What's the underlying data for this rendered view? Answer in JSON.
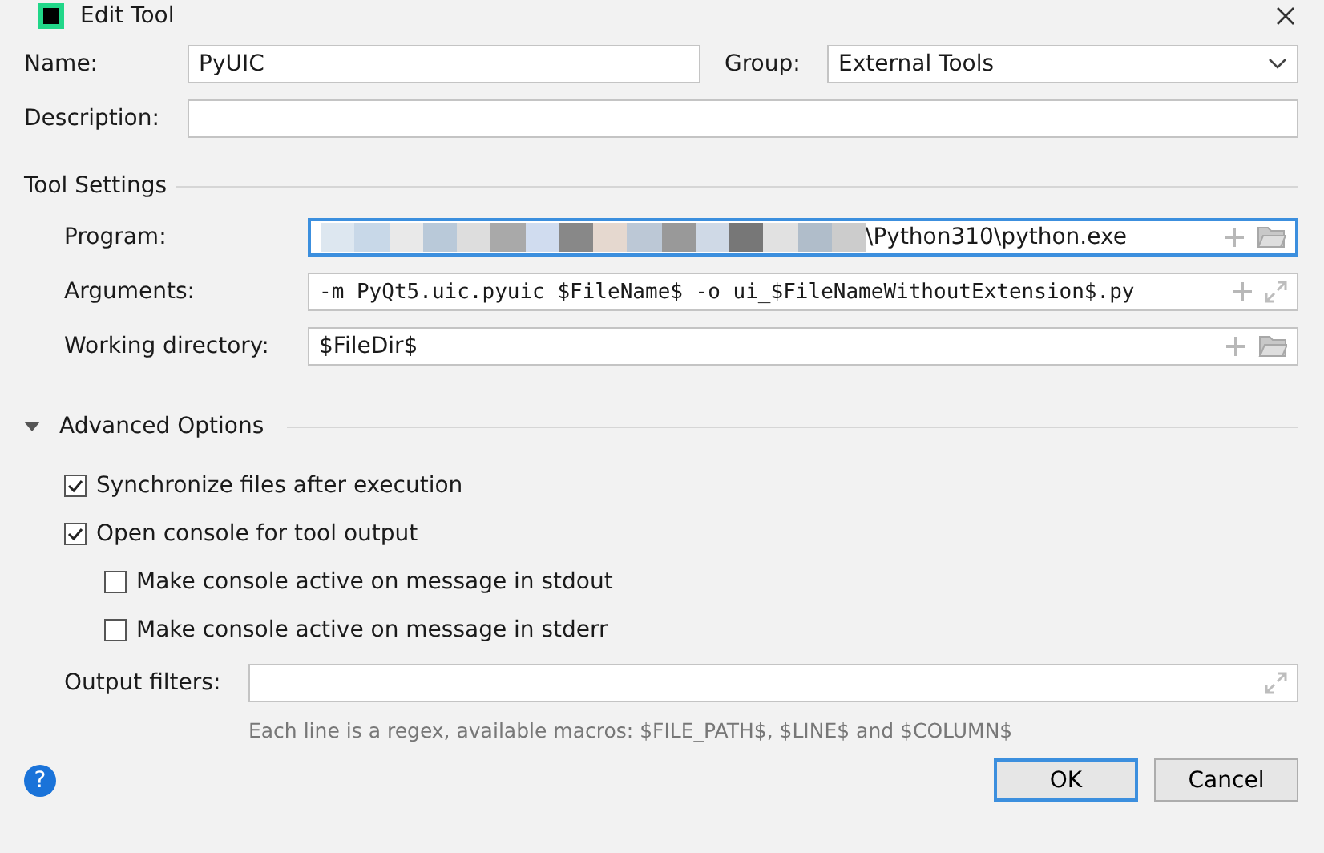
{
  "window": {
    "title": "Edit Tool"
  },
  "name": {
    "label": "Name:",
    "value": "PyUIC"
  },
  "group": {
    "label": "Group:",
    "value": "External Tools"
  },
  "description": {
    "label": "Description:"
  },
  "tool_settings": {
    "heading": "Tool Settings",
    "fields": [
      {
        "label": "Program:",
        "value": "\\Python310\\python.exe",
        "kind": "browse",
        "focused": true,
        "obscured": true,
        "mono": false
      },
      {
        "label": "Arguments:",
        "value": "-m PyQt5.uic.pyuic $FileName$ -o ui_$FileNameWithoutExtension$.py",
        "kind": "expand",
        "focused": false,
        "obscured": false,
        "mono": true
      },
      {
        "label": "Working directory:",
        "value": "$FileDir$",
        "kind": "browse",
        "focused": false,
        "obscured": false,
        "mono": false
      }
    ]
  },
  "advanced": {
    "heading": "Advanced Options",
    "expanded": true,
    "options": [
      {
        "label": "Synchronize files after execution",
        "checked": true
      },
      {
        "label": "Open console for tool output",
        "checked": true,
        "children": [
          {
            "label": "Make console active on message in stdout",
            "checked": false
          },
          {
            "label": "Make console active on message in stderr",
            "checked": false
          }
        ]
      }
    ],
    "output_filters": {
      "label": "Output filters:",
      "hint": "Each line is a regex, available macros: $FILE_PATH$, $LINE$ and $COLUMN$"
    }
  },
  "help": {
    "symbol": "?"
  },
  "buttons": [
    {
      "label": "OK",
      "default": true
    },
    {
      "label": "Cancel",
      "default": false
    }
  ]
}
